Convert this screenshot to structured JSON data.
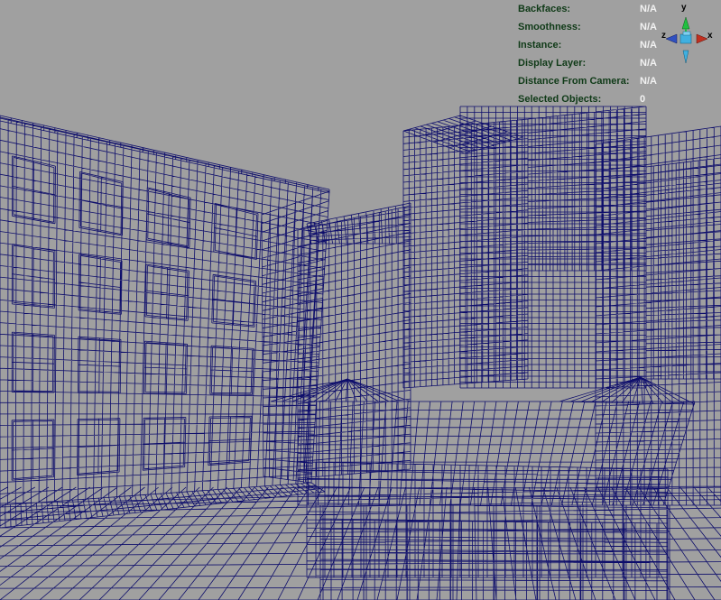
{
  "hud": {
    "rows": [
      {
        "label": "Backfaces:",
        "value": "N/A"
      },
      {
        "label": "Smoothness:",
        "value": "N/A"
      },
      {
        "label": "Instance:",
        "value": "N/A"
      },
      {
        "label": "Display Layer:",
        "value": "N/A"
      },
      {
        "label": "Distance From Camera:",
        "value": "N/A"
      },
      {
        "label": "Selected Objects:",
        "value": "0"
      }
    ]
  },
  "gizmo": {
    "y_label": "y",
    "x_label": "x",
    "z_label": "z",
    "icon": "view-axis-gizmo-icon"
  },
  "colors": {
    "background": "#a0a0a0",
    "wireframe": "#0d0d6b",
    "hud_label": "#0f3a17",
    "hud_value": "#f2f2f2",
    "axis_x": "#c03020",
    "axis_y": "#20c040",
    "axis_z": "#3050c0",
    "gizmo_center": "#40b0e0"
  }
}
